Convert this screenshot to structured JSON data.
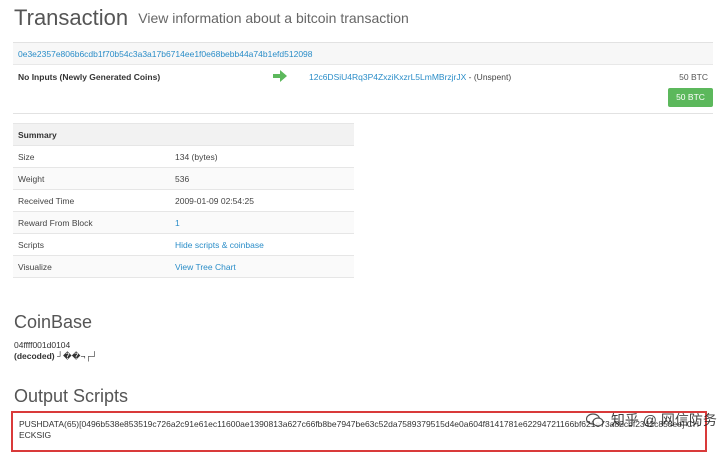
{
  "header": {
    "title": "Transaction",
    "subtitle": "View information about a bitcoin transaction"
  },
  "transaction": {
    "hash": "0e3e2357e806b6cdb1f70b54c3a3a17b6714ee1f0e68bebb44a74b1efd512098",
    "input_label": "No Inputs (Newly Generated Coins)",
    "output_address": "12c6DSiU4Rq3P4ZxziKxzrL5LmMBrzjrJX",
    "output_status": " - (Unspent)",
    "output_amount": "50 BTC",
    "total_button": "50 BTC"
  },
  "summary": {
    "heading": "Summary",
    "rows": [
      {
        "label": "Size",
        "value": "134 (bytes)"
      },
      {
        "label": "Weight",
        "value": "536"
      },
      {
        "label": "Received Time",
        "value": "2009-01-09 02:54:25"
      },
      {
        "label": "Reward From Block",
        "value": "1"
      },
      {
        "label": "Scripts",
        "value": "Hide scripts & coinbase"
      },
      {
        "label": "Visualize",
        "value": "View Tree Chart"
      }
    ]
  },
  "coinbase": {
    "heading": "CoinBase",
    "hex": "04ffff001d0104",
    "decoded_label": "(decoded)",
    "decoded_value": "┘��¬┌┘"
  },
  "output_scripts": {
    "heading": "Output Scripts",
    "script": "PUSHDATA(65)[0496b538e853519c726a2c91e61ec11600ae1390813a627c66fb8be7947be63c52da7589379515d4e0a604f8141781e62294721166bf621e73a82cbf2342c858ee] CHECKSIG"
  },
  "watermark": {
    "text": "知乎 @ 网信防务"
  },
  "colors": {
    "link": "#2a8dc8",
    "success": "#5cb85c",
    "highlight_border": "#d93a3a"
  }
}
